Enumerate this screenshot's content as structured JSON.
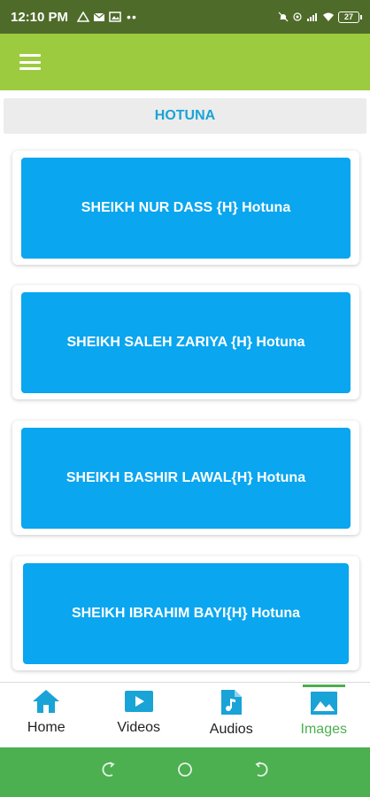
{
  "status_bar": {
    "time": "12:10 PM",
    "left_icons": [
      "warning-icon",
      "mail-icon",
      "image-icon"
    ],
    "dots": "••",
    "right_icons": [
      "mute-icon",
      "hotspot-icon",
      "signal-icon",
      "wifi-icon"
    ],
    "battery": "27"
  },
  "app_bar": {
    "menu_icon": "menu-icon",
    "color": "#9ccb3f"
  },
  "section": {
    "title": "HOTUNA"
  },
  "items": [
    {
      "label": "SHEIKH NUR DASS {H} Hotuna"
    },
    {
      "label": "SHEIKH SALEH ZARIYA {H} Hotuna"
    },
    {
      "label": "SHEIKH BASHIR LAWAL{H} Hotuna"
    },
    {
      "label": "SHEIKH IBRAHIM BAYI{H} Hotuna"
    }
  ],
  "bottom_nav": [
    {
      "label": "Home",
      "icon": "home-icon",
      "active": false
    },
    {
      "label": "Videos",
      "icon": "video-icon",
      "active": false
    },
    {
      "label": "Audios",
      "icon": "music-file-icon",
      "active": false
    },
    {
      "label": "Images",
      "icon": "image-icon",
      "active": true
    }
  ],
  "system_nav": [
    "back-icon",
    "home-circle-icon",
    "recents-icon"
  ],
  "colors": {
    "accent": "#0aa6ef",
    "active": "#4caf50",
    "header_text": "#1aa3d6"
  }
}
